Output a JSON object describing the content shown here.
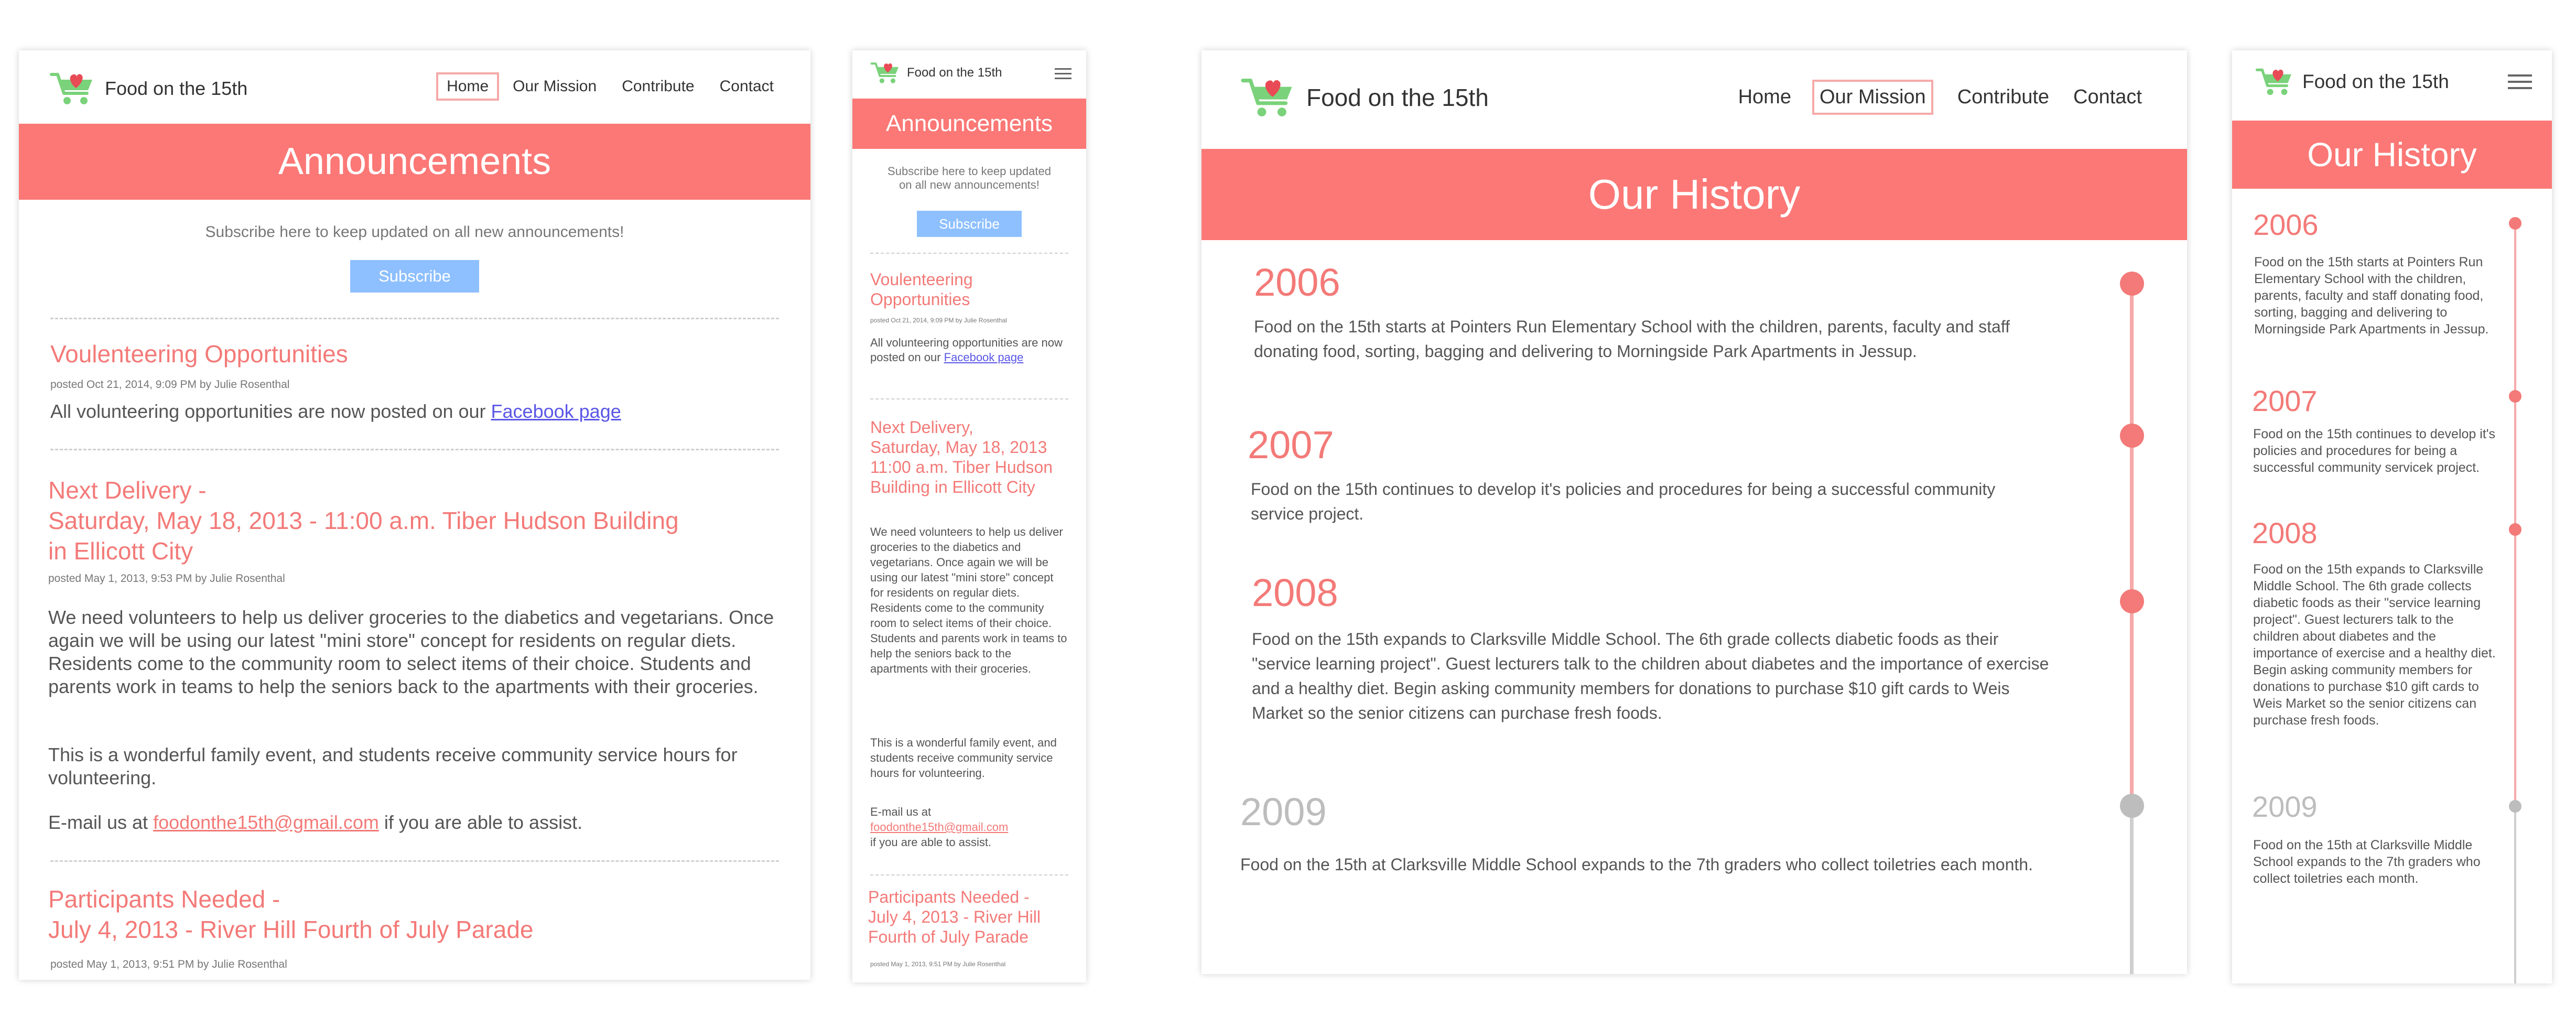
{
  "site": {
    "brand": "Food on the 15th",
    "logo_icon": "cart-heart-icon",
    "colors": {
      "accent": "#fb7876",
      "pink_text": "#f37a78",
      "button": "#8ec0ff",
      "link": "#5a56e6",
      "timeline_line": "#f6a9a9",
      "timeline_gray": "#cfcfcf"
    }
  },
  "nav": {
    "home": "Home",
    "mission": "Our Mission",
    "contribute": "Contribute",
    "contact": "Contact"
  },
  "announcements": {
    "title": "Announcements",
    "subscribe_text": "Subscribe here to keep updated on all new announcements!",
    "subscribe_text_l1": "Subscribe here to keep updated",
    "subscribe_text_l2": "on all new announcements!",
    "subscribe_button": "Subscribe",
    "posts": [
      {
        "title": "Voulenteering Opportunities",
        "meta": "posted Oct 21, 2014, 9:09 PM by Julie Rosenthal",
        "body_prefix": "All volunteering opportunities are now posted on our ",
        "link": "Facebook page"
      },
      {
        "title_l1": "Next Delivery -",
        "title_l2": "Saturday, May 18, 2013 - 11:00 a.m. Tiber Hudson Building",
        "title_l3": "in Ellicott City",
        "m_title_l1": "Next Delivery,",
        "m_title_l2": "Saturday, May 18, 2013",
        "m_title_l3": "11:00 a.m. Tiber Hudson",
        "m_title_l4": "Building in Ellicott City",
        "meta": "posted May 1, 2013, 9:53 PM by Julie Rosenthal",
        "body": "We need volunteers to help us deliver groceries to the diabetics and vegetarians.  Once again we will be using our latest \"mini store\" concept for residents on regular diets.  Residents come to the community room to select items of their choice.  Students and parents work in teams to help the seniors back to the apartments with their groceries.",
        "body2": "This is a wonderful family event, and students receive community service hours for volunteering.",
        "email_prefix": "E-mail us at ",
        "email": "foodonthe15th@gmail.com",
        "email_suffix": " if you are able to assist."
      },
      {
        "title_l1": "Participants Needed -",
        "title_l2": "July 4, 2013 - River Hill Fourth of July Parade",
        "m_title_l2": "July 4, 2013 - River Hill",
        "m_title_l3": "Fourth of July Parade",
        "meta": "posted May 1, 2013, 9:51 PM by Julie Rosenthal"
      }
    ]
  },
  "history": {
    "title": "Our History",
    "entries": [
      {
        "year": "2006",
        "text": "Food on the 15th starts at Pointers Run Elementary School with the children, parents, faculty and staff donating food, sorting, bagging and delivering to Morningside Park Apartments in Jessup."
      },
      {
        "year": "2007",
        "text": "Food on the 15th continues to develop it's policies and procedures for being a successful community service project.",
        "text_mobile": "Food on the 15th continues to develop it's policies and procedures for being a successful community servicek project."
      },
      {
        "year": "2008",
        "text": "Food on the 15th expands to Clarksville Middle School.  The 6th grade collects diabetic foods as their \"service learning project\".  Guest lecturers talk to the children about diabetes and the importance of exercise and a healthy diet.  Begin asking community members for donations to purchase $10 gift cards to Weis Market so the senior citizens can purchase fresh foods."
      },
      {
        "year": "2009",
        "text": "Food on the 15th at Clarksville Middle School expands to the 7th graders who collect toiletries each month."
      }
    ]
  }
}
